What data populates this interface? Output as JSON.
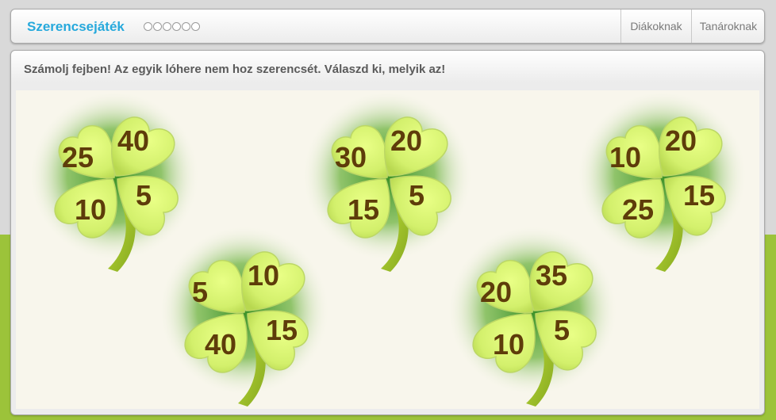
{
  "header": {
    "title": "Szerencsejáték",
    "progress_dots": 6,
    "nav": {
      "students": "Diákoknak",
      "teachers": "Tanároknak"
    }
  },
  "main": {
    "instructions": "Számolj fejben! Az egyik lóhere nem hoz szerencsét. Válaszd ki, melyik az!",
    "clovers": [
      {
        "ul": "25",
        "ur": "40",
        "ll": "10",
        "lr": "5"
      },
      {
        "ul": "5",
        "ur": "10",
        "ll": "40",
        "lr": "15"
      },
      {
        "ul": "30",
        "ur": "20",
        "ll": "15",
        "lr": "5"
      },
      {
        "ul": "20",
        "ur": "35",
        "ll": "10",
        "lr": "5"
      },
      {
        "ul": "10",
        "ur": "20",
        "ll": "25",
        "lr": "15"
      }
    ]
  },
  "colors": {
    "brand": "#27a9dc",
    "number": "#5e3c0a",
    "leaf": "#d9f777",
    "glow": "#6db33f",
    "background_band": "#9cc33a"
  }
}
